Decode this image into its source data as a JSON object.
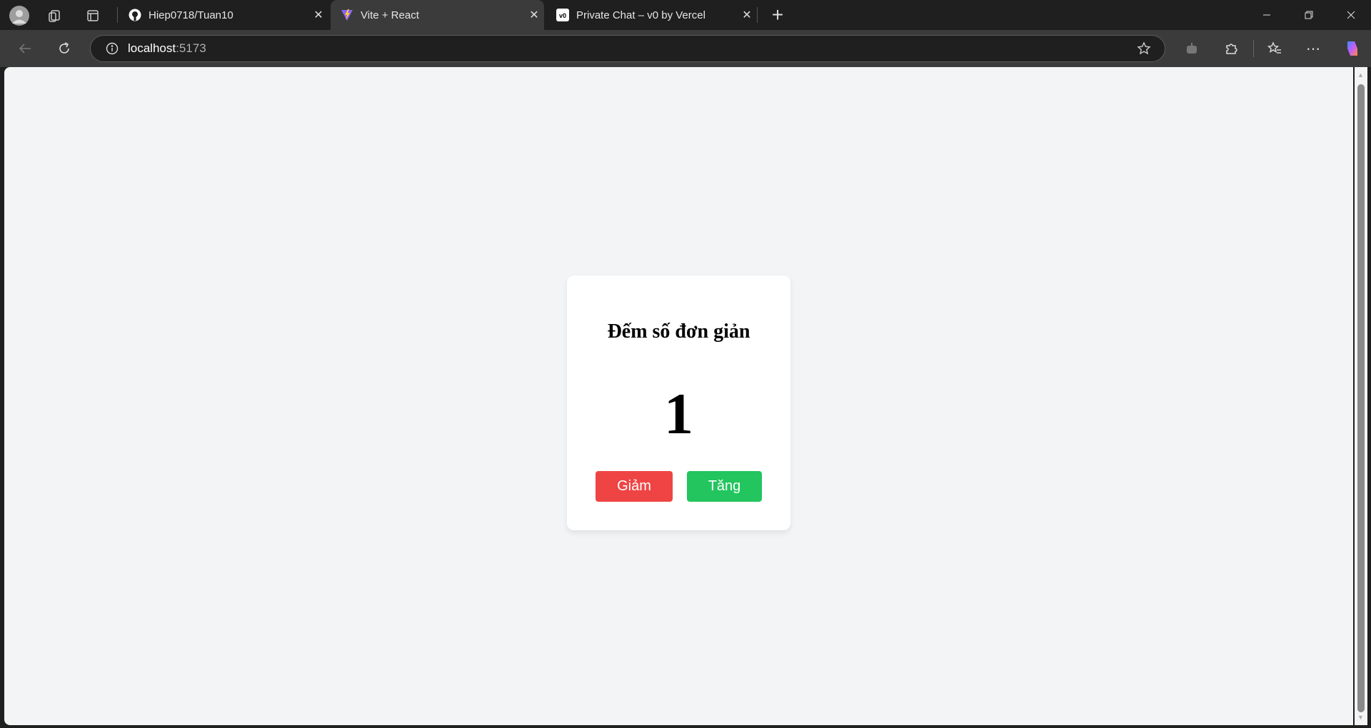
{
  "browser": {
    "tabs": [
      {
        "title": "Hiep0718/Tuan10",
        "icon": "github-icon"
      },
      {
        "title": "Vite + React",
        "icon": "vite-icon",
        "active": true
      },
      {
        "title": "Private Chat – v0 by Vercel",
        "icon": "v0-icon"
      }
    ],
    "close_glyph": "✕",
    "new_tab_glyph": "+",
    "address": {
      "host": "localhost",
      "port": ":5173"
    }
  },
  "app": {
    "title": "Đếm số đơn giản",
    "count": "1",
    "decrease_label": "Giảm",
    "increase_label": "Tăng",
    "colors": {
      "decrease": "#ef4444",
      "increase": "#22c55e",
      "background": "#f3f4f6"
    }
  }
}
